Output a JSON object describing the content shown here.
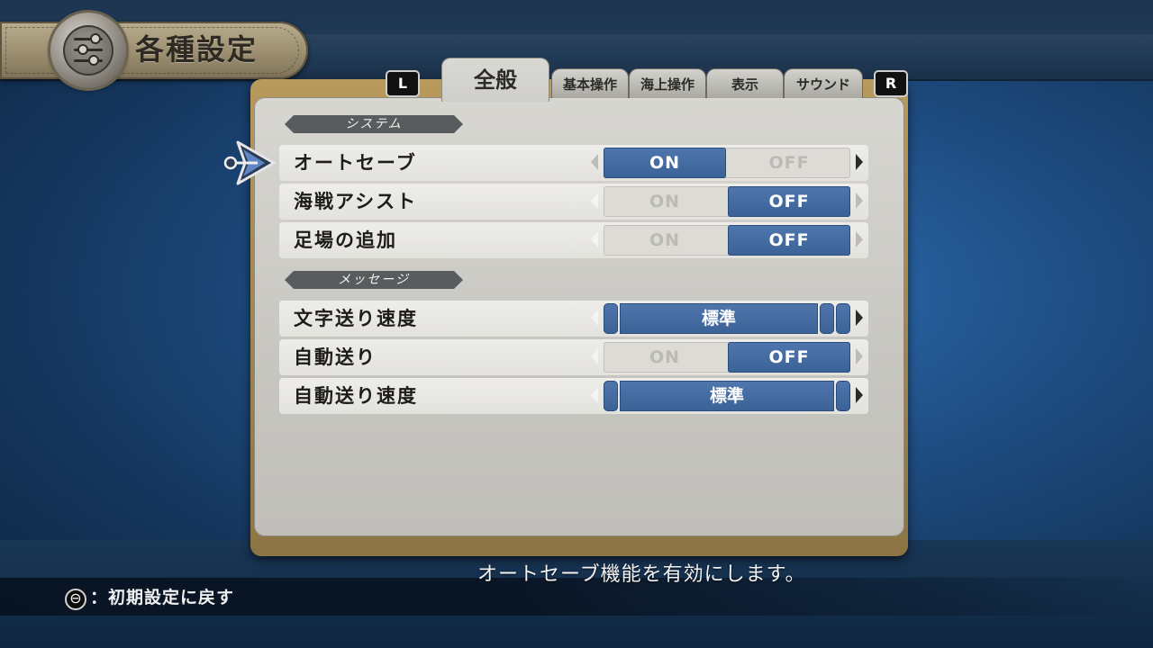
{
  "header": {
    "title": "各種設定",
    "icon": "settings-sliders-icon"
  },
  "tabs": {
    "left_shoulder": "L",
    "right_shoulder": "R",
    "items": [
      {
        "label": "全般",
        "active": true
      },
      {
        "label": "基本操作",
        "active": false
      },
      {
        "label": "海上操作",
        "active": false
      },
      {
        "label": "表示",
        "active": false
      },
      {
        "label": "サウンド",
        "active": false
      }
    ]
  },
  "sections": [
    {
      "title": "システム",
      "rows": [
        {
          "label": "オートセーブ",
          "on": "ON",
          "off": "OFF",
          "selected": "ON"
        },
        {
          "label": "海戦アシスト",
          "on": "ON",
          "off": "OFF",
          "selected": "OFF"
        },
        {
          "label": "足場の追加",
          "on": "ON",
          "off": "OFF",
          "selected": "OFF"
        }
      ]
    },
    {
      "title": "メッセージ",
      "rows": [
        {
          "label": "文字送り速度",
          "value": "標準"
        },
        {
          "label": "自動送り",
          "on": "ON",
          "off": "OFF",
          "selected": "OFF"
        },
        {
          "label": "自動送り速度",
          "value": "標準"
        }
      ]
    }
  ],
  "description": "オートセーブ機能を有効にします。",
  "footer": {
    "button_glyph": "⊖",
    "hint": "：初期設定に戻す"
  },
  "colors": {
    "selected_blue": "#4a72a8",
    "panel_bg": "#d0cfca",
    "frame_gold": "#a68a52"
  }
}
